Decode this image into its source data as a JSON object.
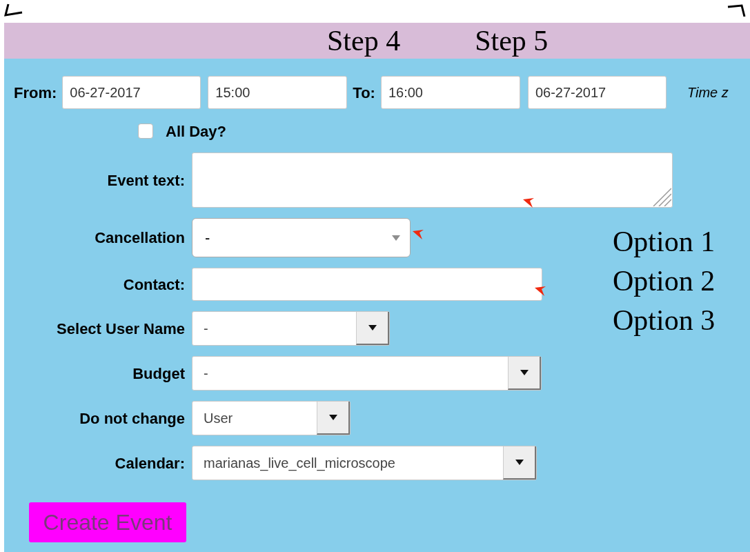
{
  "header": {
    "steps": [
      "Step 4",
      "Step 5"
    ]
  },
  "time_row": {
    "from_label": "From:",
    "from_date": "06-27-2017",
    "from_time": "15:00",
    "to_label": "To:",
    "to_time": "16:00",
    "to_date": "06-27-2017",
    "timezone_label": "Time z"
  },
  "all_day": {
    "label": "All Day?",
    "checked": false
  },
  "fields": [
    {
      "label": "Event text:",
      "kind": "textarea"
    },
    {
      "label": "Cancellation",
      "kind": "rounded_select",
      "value": "-"
    },
    {
      "label": "Contact:",
      "kind": "input"
    },
    {
      "label": "Select User Name",
      "kind": "select",
      "value": "-"
    },
    {
      "label": "Budget",
      "kind": "select",
      "value": "-"
    },
    {
      "label": "Do not change",
      "kind": "select",
      "value": "User"
    },
    {
      "label": "Calendar:",
      "kind": "select",
      "value": "marianas_live_cell_microscope"
    }
  ],
  "annotations": [
    "Option 1",
    "Option 2",
    "Option 3"
  ],
  "button": {
    "label": "Create Event"
  }
}
